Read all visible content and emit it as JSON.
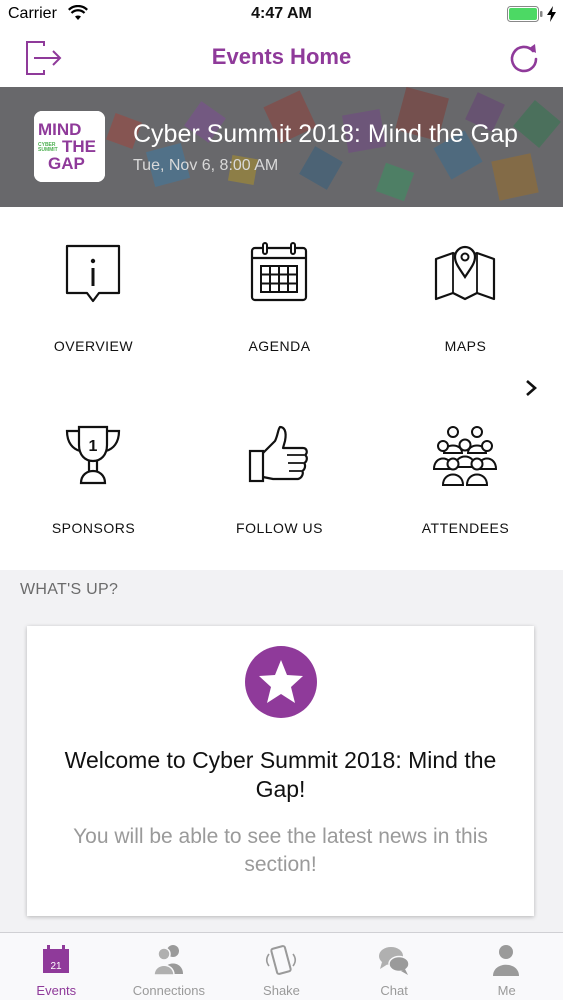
{
  "status_bar": {
    "carrier": "Carrier",
    "time": "4:47 AM"
  },
  "nav": {
    "title": "Events Home",
    "left_icon": "logout-icon",
    "right_icon": "refresh-icon"
  },
  "event": {
    "title": "Cyber Summit 2018: Mind the Gap",
    "date": "Tue, Nov 6, 8:00 AM",
    "logo_text": {
      "line1": "MIND",
      "line2": "THE",
      "line3": "GAP",
      "small": "CYBER SUMMIT"
    }
  },
  "menu": [
    {
      "label": "OVERVIEW",
      "icon": "overview-info-icon"
    },
    {
      "label": "AGENDA",
      "icon": "calendar-icon"
    },
    {
      "label": "MAPS",
      "icon": "map-pin-icon"
    },
    {
      "label": "SPONSORS",
      "icon": "trophy-icon"
    },
    {
      "label": "FOLLOW US",
      "icon": "thumbs-up-icon"
    },
    {
      "label": "ATTENDEES",
      "icon": "people-group-icon"
    }
  ],
  "whats_up": {
    "section_title": "WHAT'S UP?",
    "heading": "Welcome to Cyber Summit 2018: Mind the Gap!",
    "body": "You will be able to see the latest news in this section!"
  },
  "tabs": [
    {
      "label": "Events",
      "icon": "calendar-21-icon",
      "badge": "21",
      "active": true
    },
    {
      "label": "Connections",
      "icon": "people-icon",
      "active": false
    },
    {
      "label": "Shake",
      "icon": "phone-shake-icon",
      "active": false
    },
    {
      "label": "Chat",
      "icon": "chat-bubbles-icon",
      "active": false
    },
    {
      "label": "Me",
      "icon": "person-icon",
      "active": false
    }
  ],
  "colors": {
    "accent": "#8f3a9a",
    "logo_green": "#4caf50"
  }
}
